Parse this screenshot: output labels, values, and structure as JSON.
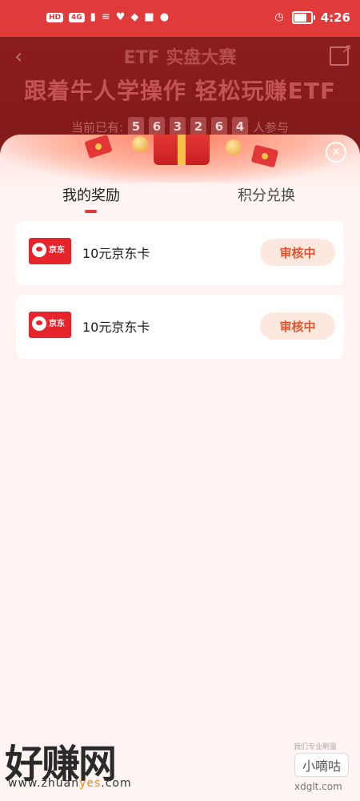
{
  "status_bar": {
    "chips": [
      "HD",
      "4G"
    ],
    "time": "4:26",
    "battery_level": 0.7
  },
  "header": {
    "title": "ETF 实盘大赛",
    "slogan": "跟着牛人学操作 轻松玩赚ETF",
    "participants_prefix": "当前已有:",
    "participant_digits": [
      "5",
      "6",
      "3",
      "2",
      "6",
      "4"
    ],
    "participants_suffix": "人参与"
  },
  "modal": {
    "tabs": [
      {
        "label": "我的奖励",
        "active": true
      },
      {
        "label": "积分兑换",
        "active": false
      }
    ],
    "rewards": [
      {
        "logo_text": "京东",
        "title": "10元京东卡",
        "status": "审核中"
      },
      {
        "logo_text": "京东",
        "title": "10元京东卡",
        "status": "审核中"
      }
    ]
  },
  "watermark": {
    "brand": "好赚网",
    "url_prefix": "www.zhuan",
    "url_highlight": "yes",
    "url_suffix": ".com",
    "right_tag": "我们专业刷量",
    "right_box": "小嘀咕",
    "right_domain": "xdglt.com"
  },
  "colors": {
    "status_bar": "#e03a3b",
    "accent": "#e33a3a",
    "badge_text": "#e2552c",
    "badge_bg": "#fde8df"
  }
}
